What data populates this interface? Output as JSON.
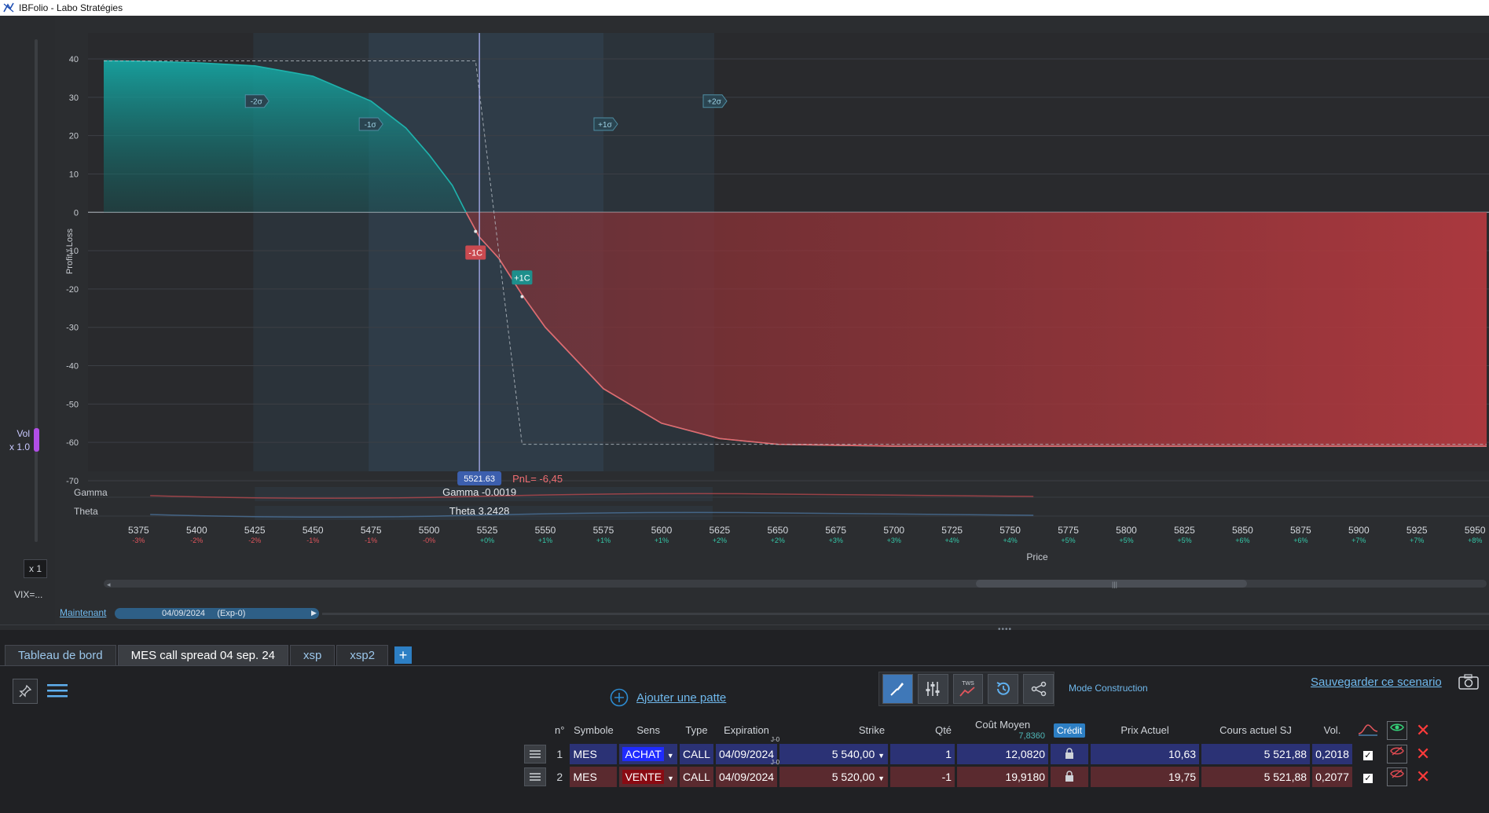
{
  "window": {
    "title": "IBFolio - Labo Stratégies"
  },
  "left_panel": {
    "vol_label": "Vol",
    "vol_mult": "x 1.0",
    "zoom": "x 1",
    "vix": "VIX=..."
  },
  "chart_data": {
    "type": "area",
    "ylabel": "Profit / Loss",
    "xlabel": "Price",
    "xlim": [
      5360,
      5955
    ],
    "ylim": [
      -70,
      40
    ],
    "yticks": [
      40,
      30,
      20,
      10,
      0,
      -10,
      -20,
      -30,
      -40,
      -50,
      -60,
      -70
    ],
    "ytick_labels": [
      "40",
      "30",
      "20",
      "10",
      "0",
      "-10",
      "-20",
      "-30",
      "-40",
      "-50",
      "-60",
      "-70"
    ],
    "xticks": [
      5375,
      5400,
      5425,
      5450,
      5475,
      5500,
      5525,
      5550,
      5575,
      5600,
      5625,
      5650,
      5675,
      5700,
      5725,
      5750,
      5775,
      5800,
      5825,
      5850,
      5875,
      5900,
      5925,
      5950
    ],
    "xtick_labels": [
      "5375",
      "5400",
      "5425",
      "5450",
      "5475",
      "5500",
      "5525",
      "5550",
      "5575",
      "5600",
      "5625",
      "5650",
      "5675",
      "5700",
      "5725",
      "5750",
      "5775",
      "5800",
      "5825",
      "5850",
      "5875",
      "5900",
      "5925",
      "5950"
    ],
    "xtick_pct": [
      "-3%",
      "-2%",
      "-2%",
      "-1%",
      "-1%",
      "-0%",
      "+0%",
      "+1%",
      "+1%",
      "+1%",
      "+2%",
      "+2%",
      "+3%",
      "+3%",
      "+4%",
      "+4%",
      "+5%",
      "+5%",
      "+5%",
      "+6%",
      "+6%",
      "+7%",
      "+7%",
      "+8%"
    ],
    "series": [
      {
        "x": [
          5360,
          5375,
          5400,
          5425,
          5450,
          5475,
          5490,
          5500,
          5510,
          5515,
          5521.63,
          5530,
          5540,
          5550,
          5575,
          5600,
          5625,
          5650,
          5700,
          5800,
          5955
        ],
        "y": [
          39.5,
          39.4,
          39.0,
          38.2,
          35.5,
          29,
          22,
          15,
          7,
          1,
          -6.45,
          -12,
          -21.5,
          -30,
          -46,
          -55,
          -59,
          -60.5,
          -61,
          -61,
          -61
        ]
      },
      {
        "x": [
          5360,
          5520,
          5540,
          5955
        ],
        "y": [
          39.5,
          39.5,
          -60.5,
          -60.5
        ]
      }
    ],
    "sigma_bands": [
      {
        "label": "-2σ",
        "price": 5425,
        "y": 29
      },
      {
        "label": "-1σ",
        "price": 5474,
        "y": 23
      },
      {
        "label": "+1σ",
        "price": 5575,
        "y": 23
      },
      {
        "label": "+2σ",
        "price": 5622,
        "y": 29
      }
    ],
    "strike_markers": [
      {
        "label": "-1C",
        "price": 5520,
        "y": -10.5
      },
      {
        "label": "+1C",
        "price": 5540,
        "y": -17
      }
    ],
    "current_price": 5521.63,
    "current_price_label": "5521.63",
    "pnl_label": "PnL= -6,45",
    "greeks": [
      {
        "name": "Gamma",
        "value_label": "Gamma -0.0019"
      },
      {
        "name": "Theta",
        "value_label": "Theta 3.2428"
      }
    ]
  },
  "timeline": {
    "now_label": "Maintenant",
    "date_label": "04/09/2024     (Exp-0)"
  },
  "tabs": [
    {
      "label": "Tableau de bord",
      "active": false
    },
    {
      "label": "MES call spread 04 sep. 24",
      "active": true
    },
    {
      "label": "xsp",
      "active": false
    },
    {
      "label": "xsp2",
      "active": false
    }
  ],
  "actions": {
    "add_leg": "Ajouter une patte",
    "mode": "Mode Construction",
    "save": "Sauvegarder ce scenario",
    "tws_label": "TWS"
  },
  "table": {
    "headers": {
      "n": "n°",
      "symbol": "Symbole",
      "side": "Sens",
      "type": "Type",
      "expiration": "Expiration",
      "strike": "Strike",
      "qty": "Qté",
      "cost": "Coût Moyen",
      "cost_sub": "7,8360",
      "credit": "Crédit",
      "current_price": "Prix Actuel",
      "underlying": "Cours actuel SJ",
      "vol": "Vol."
    },
    "rows": [
      {
        "n": "1",
        "symbol": "MES",
        "side": "ACHAT",
        "type": "CALL",
        "expiration": "04/09/2024",
        "j": "J-0",
        "strike": "5 540,00",
        "qty": "1",
        "cost": "12,0820",
        "current_price": "10,63",
        "underlying": "5 521,88",
        "vol": "0,2018"
      },
      {
        "n": "2",
        "symbol": "MES",
        "side": "VENTE",
        "type": "CALL",
        "expiration": "04/09/2024",
        "j": "J-0",
        "strike": "5 520,00",
        "qty": "-1",
        "cost": "19,9180",
        "current_price": "19,75",
        "underlying": "5 521,88",
        "vol": "0,2077"
      }
    ]
  },
  "colors": {
    "accent": "#2d7fc4",
    "profit": "#1a9c9a",
    "loss": "#e0555c",
    "link": "#6fb8ec"
  }
}
